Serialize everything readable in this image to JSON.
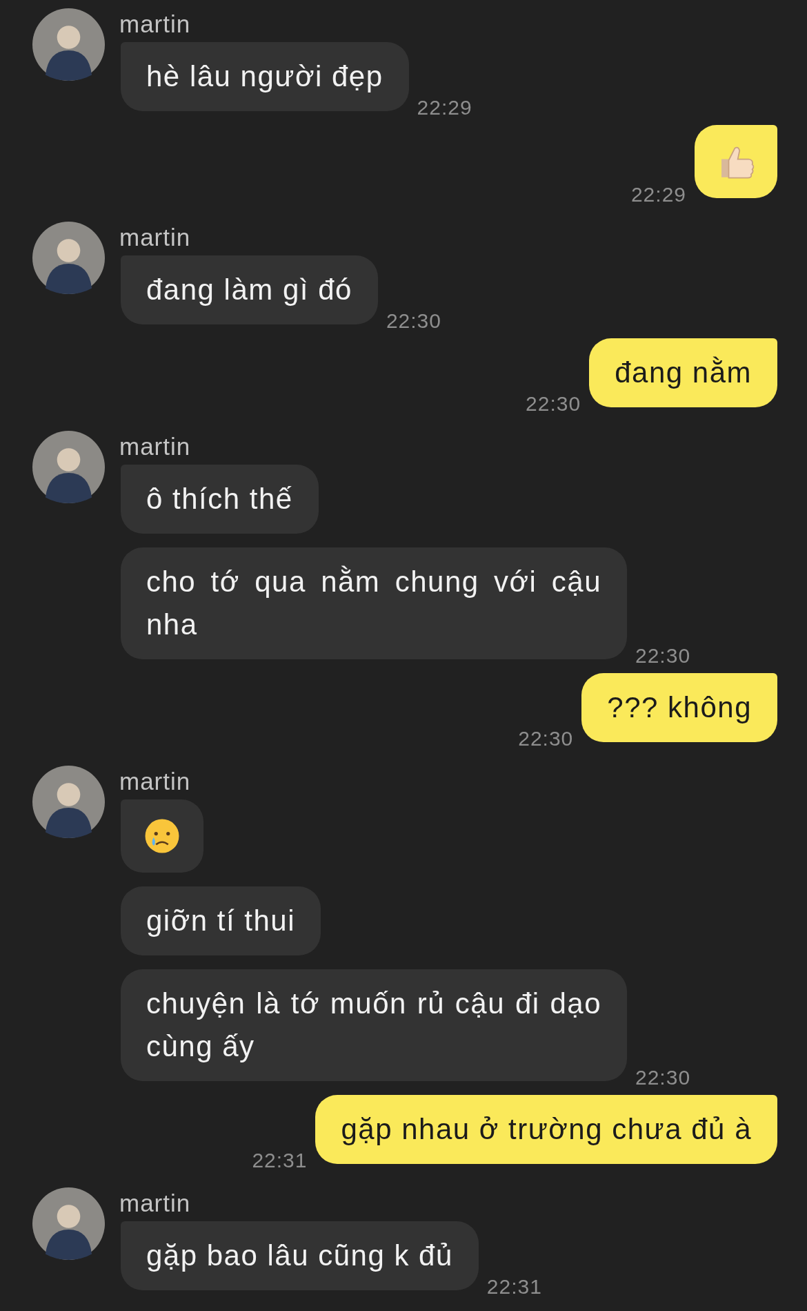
{
  "messages": [
    {
      "outgoing": false,
      "sender": "martin",
      "kind": "text",
      "text": "hè lâu người đẹp",
      "time": "22:29"
    },
    {
      "outgoing": true,
      "kind": "thumbs-up",
      "time": "22:29"
    },
    {
      "outgoing": false,
      "sender": "martin",
      "kind": "text",
      "text": "đang làm gì đó",
      "time": "22:30"
    },
    {
      "outgoing": true,
      "kind": "text",
      "text": "đang nằm",
      "time": "22:30"
    },
    {
      "outgoing": false,
      "sender": "martin",
      "kind": "text",
      "text": "ô thích thế"
    },
    {
      "outgoing": false,
      "kind": "text",
      "text": "cho tớ qua nằm chung với cậu nha",
      "time": "22:30"
    },
    {
      "outgoing": true,
      "kind": "text",
      "text": "??? không",
      "time": "22:30"
    },
    {
      "outgoing": false,
      "sender": "martin",
      "kind": "crying-face"
    },
    {
      "outgoing": false,
      "kind": "text",
      "text": "giỡn tí thui"
    },
    {
      "outgoing": false,
      "kind": "text",
      "text": "chuyện là tớ muốn rủ cậu đi dạo cùng ấy",
      "time": "22:30"
    },
    {
      "outgoing": true,
      "kind": "text",
      "text": "gặp nhau ở trường chưa đủ à",
      "time": "22:31"
    },
    {
      "outgoing": false,
      "sender": "martin",
      "kind": "text",
      "text": "gặp bao lâu cũng k đủ",
      "time": "22:31"
    }
  ]
}
